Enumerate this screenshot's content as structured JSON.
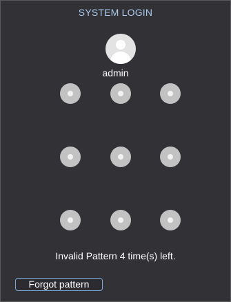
{
  "dialog": {
    "title": "SYSTEM LOGIN",
    "username": "admin",
    "pattern_dots": 9,
    "status_message": "Invalid Pattern 4 time(s) left.",
    "forgot_button_label": "Forgot pattern"
  },
  "icons": {
    "avatar": "user-avatar-icon"
  },
  "colors": {
    "background": "#323236",
    "title": "#aac8ec",
    "dot_outer": "#c2c2c2",
    "dot_inner": "#f2f2f2",
    "button_border": "#7aa7d9"
  }
}
